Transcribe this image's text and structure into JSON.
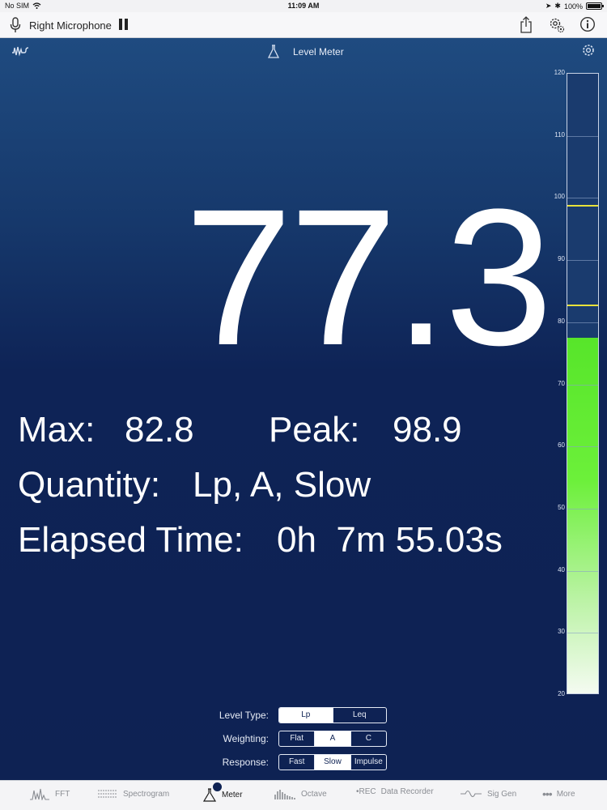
{
  "status_bar": {
    "carrier": "No SIM",
    "time": "11:09 AM",
    "battery": "100%"
  },
  "toolbar": {
    "input_label": "Right Microphone"
  },
  "header": {
    "title": "Level Meter"
  },
  "readout": {
    "value": "77.3",
    "max_label": "Max:",
    "max_value": "82.8",
    "peak_label": "Peak:",
    "peak_value": "98.9",
    "quantity_label": "Quantity:",
    "quantity_value": "Lp, A, Slow",
    "elapsed_label": "Elapsed Time:",
    "elapsed_value": "0h  7m 55.03s"
  },
  "meter": {
    "min": 20,
    "max": 120,
    "level": 77.3,
    "max_marker": 82.8,
    "peak_marker": 98.9,
    "ticks": [
      "120",
      "110",
      "100",
      "90",
      "80",
      "70",
      "60",
      "50",
      "40",
      "30",
      "20"
    ]
  },
  "controls": {
    "level_type": {
      "label": "Level Type:",
      "options": [
        "Lp",
        "Leq"
      ],
      "selected": 0
    },
    "weighting": {
      "label": "Weighting:",
      "options": [
        "Flat",
        "A",
        "C"
      ],
      "selected": 1
    },
    "response": {
      "label": "Response:",
      "options": [
        "Fast",
        "Slow",
        "Impulse"
      ],
      "selected": 1
    }
  },
  "tabs": [
    {
      "label": "FFT",
      "icon": "fft-icon"
    },
    {
      "label": "Spectrogram",
      "icon": "spectrogram-icon"
    },
    {
      "label": "Meter",
      "icon": "meter-icon"
    },
    {
      "label": "Octave",
      "icon": "octave-icon"
    },
    {
      "label": "Data Recorder",
      "icon": "rec-icon",
      "prefix": "•REC"
    },
    {
      "label": "Sig Gen",
      "icon": "sig-gen-icon"
    },
    {
      "label": "More",
      "icon": "more-icon"
    }
  ],
  "colors": {
    "background": "#0e2253",
    "meter_fill": "#6cf03a",
    "marker": "#e8e23a"
  }
}
